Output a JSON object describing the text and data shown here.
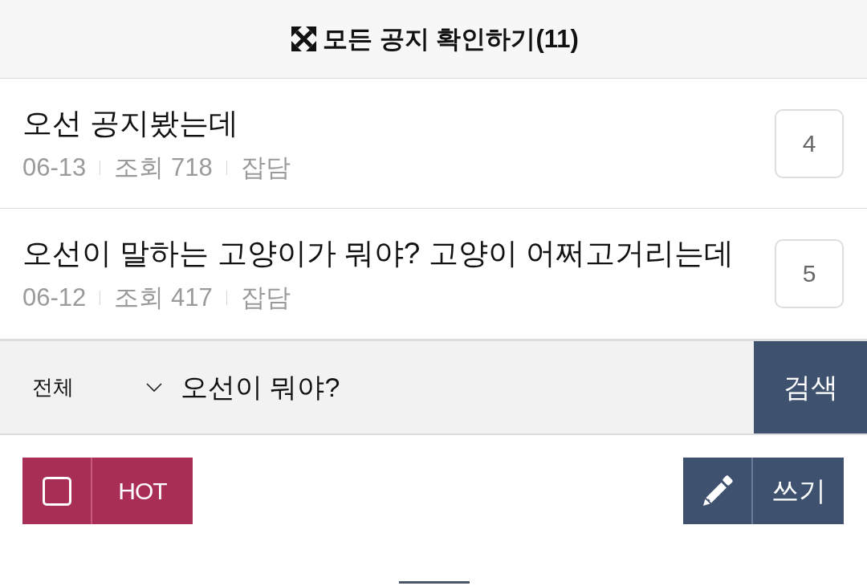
{
  "header": {
    "title": "모든 공지 확인하기(11)"
  },
  "posts": [
    {
      "title": "오선 공지봤는데",
      "date": "06-13",
      "views": "조회 718",
      "category": "잡담",
      "comments": "4"
    },
    {
      "title": "오선이 말하는 고양이가 뭐야? 고양이 어쩌고거리는데",
      "date": "06-12",
      "views": "조회 417",
      "category": "잡담",
      "comments": "5"
    }
  ],
  "search": {
    "category": "전체",
    "query": "오선이 뭐야?",
    "button": "검색"
  },
  "hot_filter": {
    "label": "HOT",
    "checked": false
  },
  "write_button": {
    "label": "쓰기"
  }
}
